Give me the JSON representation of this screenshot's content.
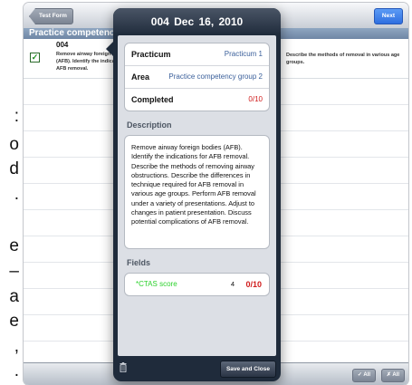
{
  "side_text": [
    ":",
    "o",
    "d",
    ".",
    "e",
    "–",
    "a",
    "e",
    ",",
    "."
  ],
  "app": {
    "back_label": "Test Form",
    "next_label": "Next",
    "section_title": "Practice competency",
    "item": {
      "code": "004",
      "checked": true,
      "text_left": "Remove airway foreign bodies (AFB). Identify the indications for AFB removal.",
      "text_right": "Describe the methods of removal in various age groups."
    },
    "bottom_chips": [
      "✓ All",
      "✗ All"
    ]
  },
  "popover": {
    "title": "004   Dec 16, 2010",
    "rows": [
      {
        "label": "Practicum",
        "value": "Practicum 1"
      },
      {
        "label": "Area",
        "value": "Practice competency group 2"
      },
      {
        "label": "Completed",
        "value": "0/10"
      }
    ],
    "description_title": "Description",
    "description": "Remove airway foreign bodies (AFB). Identify the indications for AFB removal. Describe the methods of removing airway obstructions. Describe the differences in technique required for AFB removal in various age groups. Perform AFB removal under a variety of presentations. Adjust to changes in patient presentation. Discuss potential complications of AFB removal.",
    "fields_title": "Fields",
    "field": {
      "name": "*CTAS score",
      "value": "4",
      "score": "0/10"
    },
    "save_label": "Save and Close"
  },
  "colors": {
    "popover_bg": "#1f2b3b",
    "accent_blue": "#2f6fe0",
    "score_red": "#d01c1c",
    "field_green": "#2bd12b"
  }
}
